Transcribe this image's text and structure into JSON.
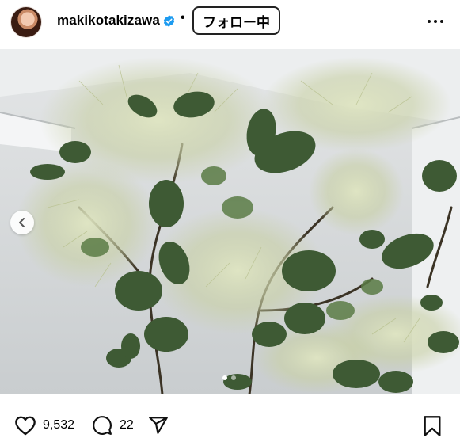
{
  "header": {
    "username": "makikotakizawa",
    "separator": "•",
    "follow_label": "フォロー中"
  },
  "post": {
    "image_description_icon": "photo",
    "carousel_dots": 2,
    "active_dot": 1
  },
  "actions": {
    "likes": "9,532",
    "comments": "22"
  },
  "icons": {
    "verified": "verified-badge-icon",
    "more": "more-options-icon",
    "prev": "chevron-left-icon",
    "like": "heart-icon",
    "comment": "comment-icon",
    "share": "send-icon",
    "save": "bookmark-icon"
  },
  "colors": {
    "verified": "#1d9bf0",
    "text": "#000000",
    "leaf_dark": "#2f4a2a",
    "leaf_mid": "#4c6b3c",
    "plume": "#c9d2a8",
    "sky": "#d9dcdd"
  }
}
